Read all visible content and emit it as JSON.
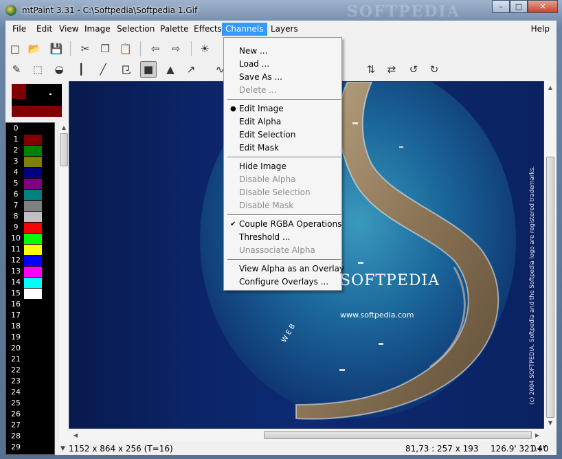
{
  "window": {
    "title": "mtPaint 3.31 - C:\\Softpedia\\Softpedia 1.Gif",
    "watermark": "SOFTPEDIA",
    "controls": {
      "minimize": "–",
      "maximize": "□",
      "close": "✕"
    }
  },
  "menubar": {
    "items": [
      "File",
      "Edit",
      "View",
      "Image",
      "Selection",
      "Palette",
      "Effects",
      "Channels",
      "Layers"
    ],
    "help": "Help",
    "active": "Channels"
  },
  "toolbar_top": [
    {
      "name": "new-icon",
      "glyph": "□"
    },
    {
      "name": "open-folder-icon",
      "glyph": "📂"
    },
    {
      "name": "save-icon",
      "glyph": "💾"
    },
    {
      "name": "cut-icon",
      "glyph": "✂"
    },
    {
      "name": "copy-icon",
      "glyph": "❐"
    },
    {
      "name": "paste-icon",
      "glyph": "📋"
    },
    {
      "name": "undo-icon",
      "glyph": "⇦"
    },
    {
      "name": "redo-icon",
      "glyph": "⇨"
    },
    {
      "name": "sun-icon",
      "glyph": "☀"
    }
  ],
  "toolbar_tools": [
    {
      "name": "pencil-icon",
      "glyph": "✎"
    },
    {
      "name": "select-rect-icon",
      "glyph": "⬚"
    },
    {
      "name": "fill-icon",
      "glyph": "◒"
    },
    {
      "name": "ruler-icon",
      "glyph": "┃"
    },
    {
      "name": "smudge-icon",
      "glyph": "╱"
    },
    {
      "name": "clone-icon",
      "glyph": "⺋"
    },
    {
      "name": "paint-icon",
      "glyph": "■",
      "pressed": true
    },
    {
      "name": "shape-icon",
      "glyph": "▲"
    },
    {
      "name": "gradient-icon",
      "glyph": "↗"
    },
    {
      "name": "lasso-icon",
      "glyph": "∿"
    },
    {
      "name": "flip-vertical-icon",
      "glyph": "⇅"
    },
    {
      "name": "flip-horizontal-icon",
      "glyph": "⇄"
    },
    {
      "name": "rotate-left-icon",
      "glyph": "↺"
    },
    {
      "name": "rotate-right-icon",
      "glyph": "↻"
    }
  ],
  "palette": [
    {
      "index": "0",
      "color": "#000000"
    },
    {
      "index": "1",
      "color": "#800000"
    },
    {
      "index": "2",
      "color": "#008000"
    },
    {
      "index": "3",
      "color": "#808000"
    },
    {
      "index": "4",
      "color": "#000080"
    },
    {
      "index": "5",
      "color": "#800080"
    },
    {
      "index": "6",
      "color": "#008080"
    },
    {
      "index": "7",
      "color": "#808080"
    },
    {
      "index": "8",
      "color": "#c0c0c0"
    },
    {
      "index": "9",
      "color": "#ff0000"
    },
    {
      "index": "10",
      "color": "#00ff00"
    },
    {
      "index": "11",
      "color": "#ffff00"
    },
    {
      "index": "12",
      "color": "#0000ff"
    },
    {
      "index": "13",
      "color": "#ff00ff"
    },
    {
      "index": "14",
      "color": "#00ffff"
    },
    {
      "index": "15",
      "color": "#ffffff"
    },
    {
      "index": "16",
      "color": "#000000"
    },
    {
      "index": "17",
      "color": "#000000"
    },
    {
      "index": "18",
      "color": "#000000"
    },
    {
      "index": "19",
      "color": "#000000"
    },
    {
      "index": "20",
      "color": "#000000"
    },
    {
      "index": "21",
      "color": "#000000"
    },
    {
      "index": "22",
      "color": "#000000"
    },
    {
      "index": "23",
      "color": "#000000"
    },
    {
      "index": "24",
      "color": "#000000"
    },
    {
      "index": "25",
      "color": "#000000"
    },
    {
      "index": "26",
      "color": "#000000"
    },
    {
      "index": "27",
      "color": "#000000"
    },
    {
      "index": "28",
      "color": "#000000"
    },
    {
      "index": "29",
      "color": "#000000"
    }
  ],
  "channels_menu": [
    {
      "label": "New ...",
      "enabled": true
    },
    {
      "label": "Load ...",
      "enabled": true
    },
    {
      "label": "Save As ...",
      "enabled": true
    },
    {
      "label": "Delete ...",
      "enabled": false
    },
    {
      "sep": true
    },
    {
      "label": "Edit Image",
      "enabled": true,
      "mark": "●"
    },
    {
      "label": "Edit Alpha",
      "enabled": true
    },
    {
      "label": "Edit Selection",
      "enabled": true
    },
    {
      "label": "Edit Mask",
      "enabled": true
    },
    {
      "sep": true
    },
    {
      "label": "Hide Image",
      "enabled": true
    },
    {
      "label": "Disable Alpha",
      "enabled": false
    },
    {
      "label": "Disable Selection",
      "enabled": false
    },
    {
      "label": "Disable Mask",
      "enabled": false
    },
    {
      "sep": true
    },
    {
      "label": "Couple RGBA Operations",
      "enabled": true,
      "mark": "✔"
    },
    {
      "label": "Threshold ...",
      "enabled": true
    },
    {
      "label": "Unassociate Alpha",
      "enabled": false
    },
    {
      "sep": true
    },
    {
      "label": "View Alpha as an Overlay",
      "enabled": true
    },
    {
      "label": "Configure Overlays ...",
      "enabled": true
    }
  ],
  "canvas_text": {
    "brand": "SOFTPEDIA",
    "trademark": "™",
    "url": "www.softpedia.com",
    "web": "WEB",
    "side": "(c) 2004 SOFTPEDIA. Softpedia and the Softpedia logo are registered trademarks."
  },
  "status": {
    "image_info": "1152 x 864 x 256  (T=16)",
    "coords": "81,73 : 257 x 193",
    "angle": "126.9' 321.4\"",
    "offset": "0+0"
  }
}
